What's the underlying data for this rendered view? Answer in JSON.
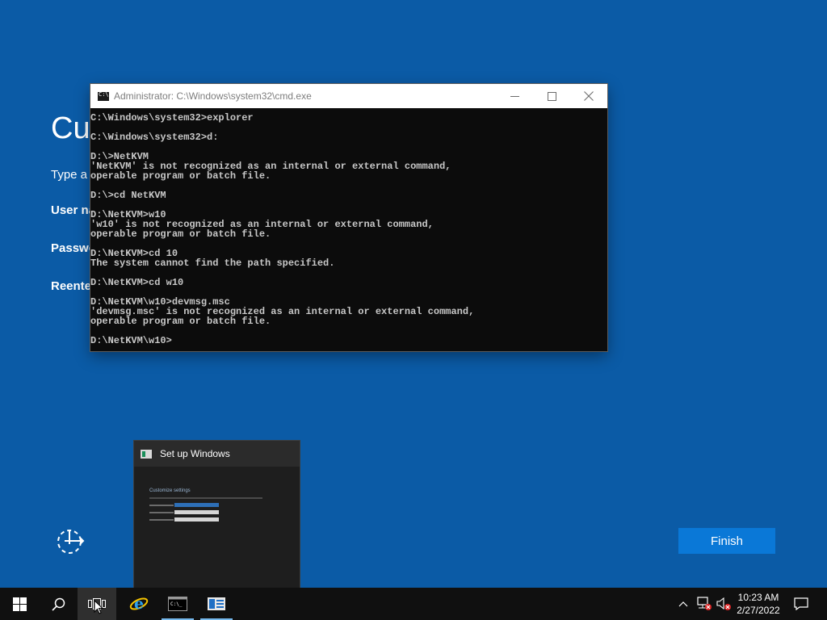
{
  "setup": {
    "title": "Cus",
    "subtitle": "Type a",
    "user_name_label": "User na",
    "password_label": "Passwo",
    "reenter_label": "Reente",
    "finish_label": "Finish"
  },
  "cmd": {
    "title": "Administrator: C:\\Windows\\system32\\cmd.exe",
    "lines": [
      "C:\\Windows\\system32>explorer",
      "",
      "C:\\Windows\\system32>d:",
      "",
      "D:\\>NetKVM",
      "'NetKVM' is not recognized as an internal or external command,",
      "operable program or batch file.",
      "",
      "D:\\>cd NetKVM",
      "",
      "D:\\NetKVM>w10",
      "'w10' is not recognized as an internal or external command,",
      "operable program or batch file.",
      "",
      "D:\\NetKVM>cd 10",
      "The system cannot find the path specified.",
      "",
      "D:\\NetKVM>cd w10",
      "",
      "D:\\NetKVM\\w10>devmsg.msc",
      "'devmsg.msc' is not recognized as an internal or external command,",
      "operable program or batch file.",
      "",
      "D:\\NetKVM\\w10>"
    ]
  },
  "thumbnail": {
    "title": "Set up Windows",
    "preview_heading": "Customize settings"
  },
  "taskbar": {
    "time": "10:23 AM",
    "date": "2/27/2022",
    "icons": [
      "windows-start-icon",
      "search-icon",
      "task-view-icon",
      "internet-explorer-icon",
      "command-prompt-icon",
      "setup-windows-icon"
    ],
    "tray_icons": [
      "show-hidden-icons-chevron",
      "network-disconnected-icon",
      "volume-muted-icon",
      "action-center-icon"
    ]
  },
  "colors": {
    "desktop_bg": "#0b5ba6",
    "finish_button": "#0a78d7",
    "taskbar_bg": "#101010",
    "cmd_bg": "#0c0c0c"
  }
}
